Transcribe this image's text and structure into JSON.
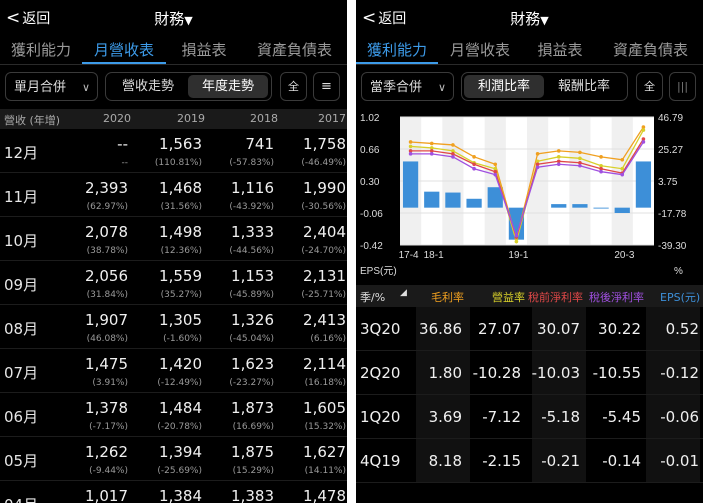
{
  "left": {
    "back_label": "返回",
    "title": "財務",
    "tabs": [
      "獲利能力",
      "月營收表",
      "損益表",
      "資產負債表"
    ],
    "active_tab": 1,
    "select_label": "單月合併",
    "seg": [
      "營收走勢",
      "年度走勢"
    ],
    "seg_active": 1,
    "btn_full": "全",
    "btn_menu": "menu-icon",
    "header": {
      "label": "營收 (年增)",
      "years": [
        "2020",
        "2019",
        "2018",
        "2017"
      ]
    },
    "rows": [
      {
        "month": "12月",
        "vals": [
          "--",
          "1,563",
          "741",
          "1,758"
        ],
        "pcts": [
          "--",
          "(110.81%)",
          "(-57.83%)",
          "(-46.49%)"
        ]
      },
      {
        "month": "11月",
        "vals": [
          "2,393",
          "1,468",
          "1,116",
          "1,990"
        ],
        "pcts": [
          "(62.97%)",
          "(31.56%)",
          "(-43.92%)",
          "(-30.56%)"
        ]
      },
      {
        "month": "10月",
        "vals": [
          "2,078",
          "1,498",
          "1,333",
          "2,404"
        ],
        "pcts": [
          "(38.78%)",
          "(12.36%)",
          "(-44.56%)",
          "(-24.70%)"
        ]
      },
      {
        "month": "09月",
        "vals": [
          "2,056",
          "1,559",
          "1,153",
          "2,131"
        ],
        "pcts": [
          "(31.84%)",
          "(35.27%)",
          "(-45.89%)",
          "(-25.71%)"
        ]
      },
      {
        "month": "08月",
        "vals": [
          "1,907",
          "1,305",
          "1,326",
          "2,413"
        ],
        "pcts": [
          "(46.08%)",
          "(-1.60%)",
          "(-45.04%)",
          "(6.16%)"
        ]
      },
      {
        "month": "07月",
        "vals": [
          "1,475",
          "1,420",
          "1,623",
          "2,114"
        ],
        "pcts": [
          "(3.91%)",
          "(-12.49%)",
          "(-23.27%)",
          "(16.18%)"
        ]
      },
      {
        "month": "06月",
        "vals": [
          "1,378",
          "1,484",
          "1,873",
          "1,605"
        ],
        "pcts": [
          "(-7.17%)",
          "(-20.78%)",
          "(16.69%)",
          "(15.32%)"
        ]
      },
      {
        "month": "05月",
        "vals": [
          "1,262",
          "1,394",
          "1,875",
          "1,627"
        ],
        "pcts": [
          "(-9.44%)",
          "(-25.69%)",
          "(15.29%)",
          "(14.11%)"
        ]
      },
      {
        "month": "04月",
        "vals": [
          "1,017",
          "1,384",
          "1,383",
          "1,478"
        ],
        "pcts": [
          "",
          "",
          "",
          ""
        ]
      }
    ]
  },
  "right": {
    "back_label": "返回",
    "title": "財務",
    "tabs": [
      "獲利能力",
      "月營收表",
      "損益表",
      "資產負債表"
    ],
    "active_tab": 0,
    "select_label": "當季合併",
    "seg": [
      "利潤比率",
      "報酬比率"
    ],
    "seg_active": 0,
    "btn_full": "全",
    "btn_chart": "waveform-icon",
    "chart_data": {
      "type": "bar",
      "categories": [
        "17-4",
        "18-1",
        "",
        "",
        "",
        "19-1",
        "",
        "",
        "",
        "",
        "20-3",
        ""
      ],
      "x_tick_labels": [
        "17-4",
        "18-1",
        "19-1",
        "20-3"
      ],
      "left_axis_ticks": [
        "1.02",
        "0.66",
        "0.30",
        "-0.06",
        "-0.42"
      ],
      "right_axis_ticks": [
        "46.79",
        "25.27",
        "3.75",
        "-17.78",
        "-39.30"
      ],
      "left_axis_label": "EPS(元)",
      "right_axis_label": "%",
      "ylim_left": [
        -0.42,
        1.02
      ],
      "ylim_right": [
        -39.3,
        46.79
      ],
      "series": [
        {
          "name": "EPS(元)",
          "kind": "bar",
          "color": "#3d8fd8",
          "values": [
            0.52,
            0.18,
            0.17,
            0.1,
            0.23,
            -0.36,
            0.0,
            0.04,
            0.04,
            -0.01,
            -0.06,
            0.52
          ]
        },
        {
          "name": "毛利率",
          "kind": "line",
          "color": "#f0a020",
          "values": [
            30,
            29,
            28,
            20,
            15,
            -35,
            22,
            24,
            23,
            20,
            18,
            40
          ]
        },
        {
          "name": "營益率",
          "kind": "line",
          "color": "#d8d02a",
          "values": [
            27,
            26,
            24,
            16,
            12,
            -37,
            17,
            20,
            19,
            14,
            12,
            38
          ]
        },
        {
          "name": "稅前淨利率",
          "kind": "line",
          "color": "#e04848",
          "values": [
            24,
            24,
            22,
            15,
            10,
            -34,
            15,
            17,
            16,
            12,
            9,
            32
          ]
        },
        {
          "name": "稅後淨利率",
          "kind": "line",
          "color": "#a050e0",
          "values": [
            22,
            22,
            20,
            12,
            8,
            -33,
            13,
            15,
            14,
            10,
            8,
            30
          ]
        }
      ]
    },
    "table_header": {
      "season": "季/%",
      "cols": [
        "毛利率",
        "營益率",
        "稅前淨利率",
        "稅後淨利率",
        "EPS(元)"
      ],
      "col_colors": [
        "#f0a020",
        "#d8d02a",
        "#e04848",
        "#a050e0",
        "#3d8fd8"
      ]
    },
    "table_rows": [
      {
        "season": "3Q20",
        "vals": [
          "36.86",
          "27.07",
          "30.07",
          "30.22",
          "0.52"
        ]
      },
      {
        "season": "2Q20",
        "vals": [
          "1.80",
          "-10.28",
          "-10.03",
          "-10.55",
          "-0.12"
        ]
      },
      {
        "season": "1Q20",
        "vals": [
          "3.69",
          "-7.12",
          "-5.18",
          "-5.45",
          "-0.06"
        ]
      },
      {
        "season": "4Q19",
        "vals": [
          "8.18",
          "-2.15",
          "-0.21",
          "-0.14",
          "-0.01"
        ]
      }
    ]
  }
}
